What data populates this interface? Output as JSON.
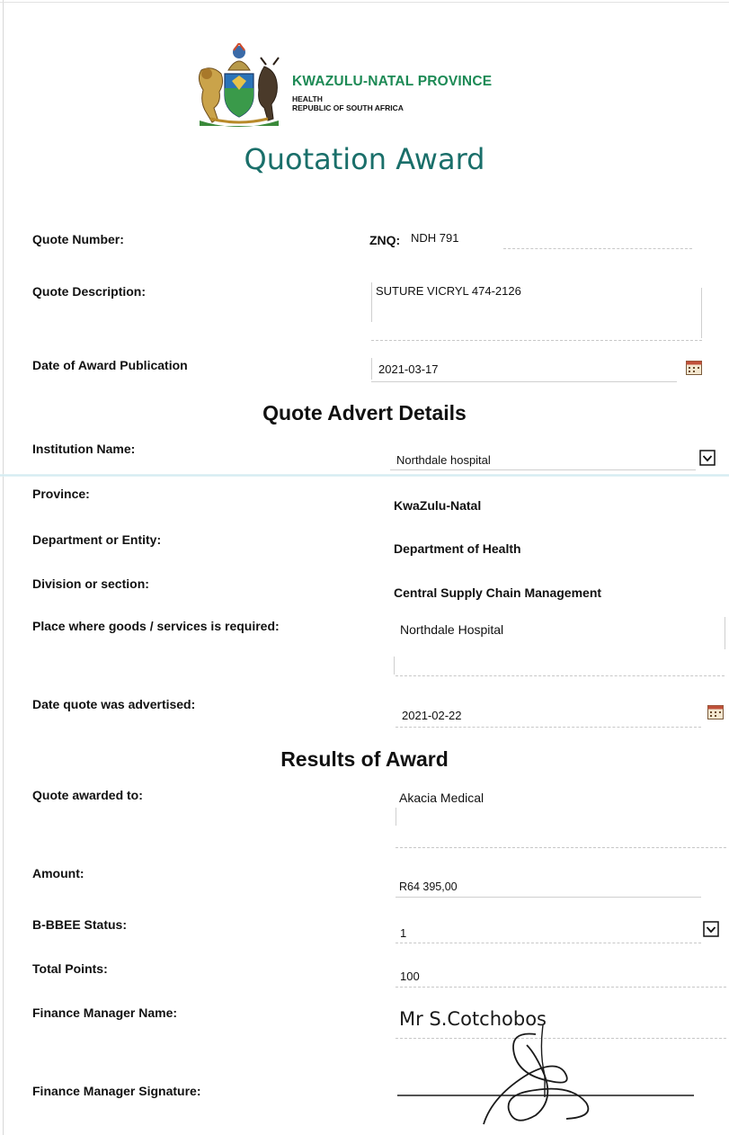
{
  "header": {
    "province": "KWAZULU-NATAL PROVINCE",
    "line1": "HEALTH",
    "line2": "REPUBLIC OF SOUTH AFRICA"
  },
  "title": "Quotation Award",
  "quote": {
    "number_label": "Quote Number:",
    "number_prefix": "ZNQ:",
    "number_value": "NDH 791",
    "description_label": "Quote Description:",
    "description_value": "SUTURE VICRYL 474-2126",
    "publication_label": "Date of Award Publication",
    "publication_value": "2021-03-17"
  },
  "advert": {
    "heading": "Quote Advert Details",
    "institution_label": "Institution Name:",
    "institution_value": "Northdale hospital",
    "province_label": "Province:",
    "province_value": "KwaZulu-Natal",
    "department_label": "Department or Entity:",
    "department_value": "Department of Health",
    "division_label": "Division or section:",
    "division_value": "Central Supply Chain Management",
    "place_label": "Place where goods /  services is required:",
    "place_value": "Northdale Hospital",
    "advertised_label": "Date quote was advertised:",
    "advertised_value": "2021-02-22"
  },
  "results": {
    "heading": "Results of Award",
    "awarded_label": "Quote awarded to:",
    "awarded_value": "Akacia Medical",
    "amount_label": "Amount:",
    "amount_value": "R64 395,00",
    "bbbee_label": "B-BBEE Status:",
    "bbbee_value": "1",
    "points_label": "Total Points:",
    "points_value": "100",
    "manager_label": "Finance Manager Name:",
    "manager_value": "Mr S.Cotchobos",
    "signature_label": "Finance Manager Signature:"
  },
  "icons": {
    "crest": "provincial-coat-of-arms",
    "calendar": "calendar-icon",
    "dropdown": "chevron-down-icon"
  },
  "colors": {
    "province_green": "#1d8a55",
    "title_teal": "#1a6f6a"
  }
}
